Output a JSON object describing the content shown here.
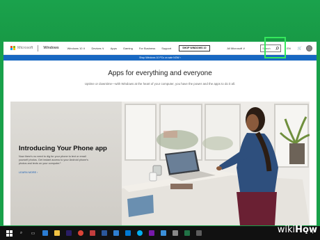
{
  "nav": {
    "brand": "Microsoft",
    "section": "Windows",
    "items": [
      "Windows 10 ∨",
      "Devices ∨",
      "Apps",
      "Gaming",
      "For Business",
      "Support"
    ],
    "shop_button": "SHOP WINDOWS 10",
    "all_microsoft": "All Microsoft ∨",
    "search_label": "Search",
    "search_icon": "magnifier-icon",
    "language": "EN",
    "cart_icon": "cart-icon"
  },
  "promo": {
    "text": "Shop Windows 10 PCs on sale NOW ›"
  },
  "main": {
    "headline": "Apps for everything and everyone",
    "subline": "Uptime or downtime—with Windows at the heart of your computer, you have the power and the apps to do it all."
  },
  "hero": {
    "title": "Introducing Your Phone app",
    "body": "Now there's no need to dig for your phone to text or email yourself photos. Get instant access to your Android phone's photos and texts on your computer.¹",
    "learn_more": "LEARN MORE ›"
  },
  "taskbar": {
    "apps": [
      "search-icon",
      "task-view-icon",
      "edge-icon",
      "explorer-icon",
      "premiere-icon",
      "chrome-icon",
      "paint-icon",
      "word-icon",
      "store-icon",
      "mail-icon",
      "skype-icon",
      "onenote-icon",
      "photos-icon",
      "calculator-icon",
      "excel-icon",
      "settings-icon"
    ],
    "colors": [
      "#2b7cd3",
      "#f2c343",
      "#2a1e66",
      "#db4437",
      "#c33d3d",
      "#2b579a",
      "#2f7fd1",
      "#0078d4",
      "#00aff0",
      "#7719aa",
      "#3b8fd9",
      "#888888",
      "#217346",
      "#5c5c5c"
    ]
  },
  "watermark": {
    "wiki": "wiki",
    "how": "How"
  },
  "colors": {
    "promo_bar": "#1868c2",
    "desktop_green": "#19a14a",
    "highlight": "#35e85c"
  }
}
